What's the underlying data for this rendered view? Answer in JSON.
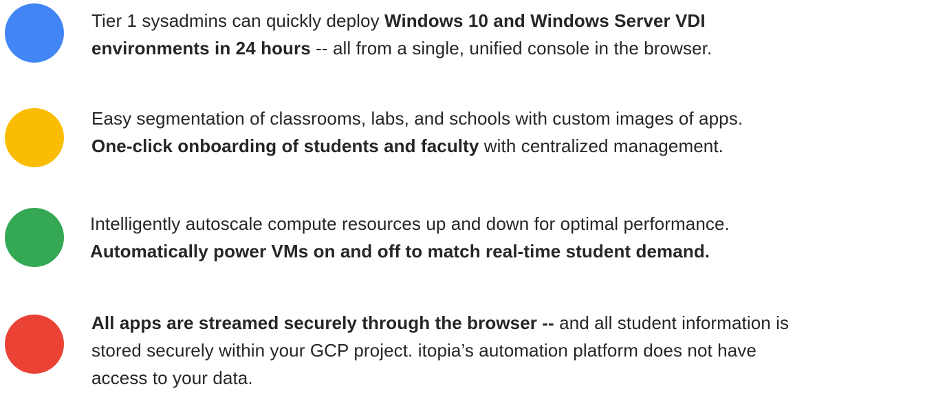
{
  "colors": {
    "blue": "#4285f4",
    "yellow": "#fbbc04",
    "green": "#34a853",
    "red": "#ea4335"
  },
  "items": [
    {
      "dot_color": "blue",
      "line1_a": "Tier 1 sysadmins can quickly deploy ",
      "line1_bold": "Windows 10 and Windows Server VDI",
      "line2_bold": "environments in 24 hours",
      "line2_b": " -- all from a single, unified console in the browser."
    },
    {
      "dot_color": "yellow",
      "line1": "Easy segmentation of classrooms, labs, and schools with custom images of apps.",
      "line2_bold": "One-click onboarding of students and faculty",
      "line2_b": " with centralized management."
    },
    {
      "dot_color": "green",
      "line1": "Intelligently autoscale compute resources up and down for optimal performance.",
      "line2_bold": "Automatically power VMs on and off to match real-time student demand."
    },
    {
      "dot_color": "red",
      "line1_bold": "All apps are streamed securely through the browser --",
      "line1_b": " and all student information is",
      "line2": "stored securely within your GCP project. itopia’s automation platform does not have",
      "line3": "access to your data."
    }
  ]
}
